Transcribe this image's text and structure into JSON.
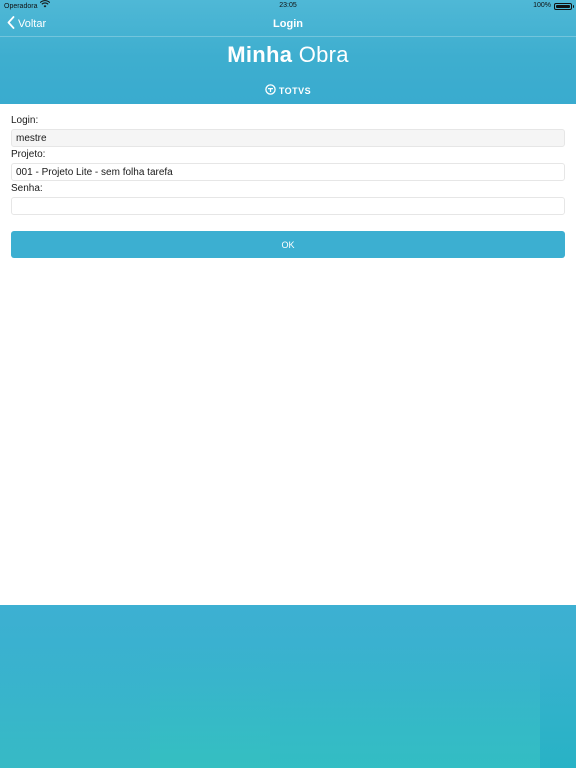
{
  "status_bar": {
    "carrier": "Operadora",
    "time": "23:05",
    "battery": "100%"
  },
  "nav": {
    "back_label": "Voltar",
    "title": "Login"
  },
  "header": {
    "app_title_bold": "Minha",
    "app_title_light": "Obra",
    "brand": "TOTVS"
  },
  "form": {
    "login_label": "Login:",
    "login_value": "mestre",
    "project_label": "Projeto:",
    "project_value": "001 - Projeto Lite - sem folha tarefa",
    "password_label": "Senha:",
    "password_value": "",
    "ok_label": "OK"
  },
  "colors": {
    "accent": "#3cafd1",
    "header_top": "#4fb8d6",
    "footer_bottom": "#2fb8c4"
  }
}
